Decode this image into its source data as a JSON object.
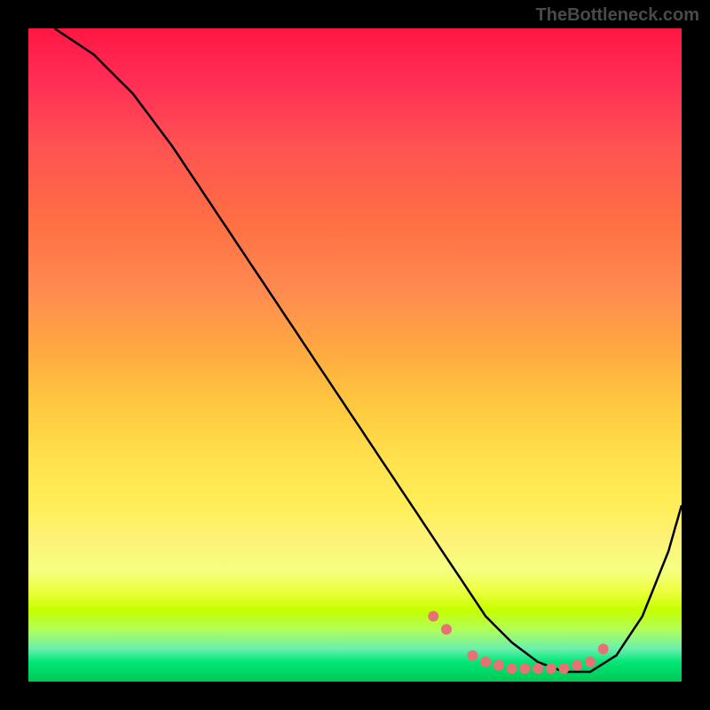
{
  "watermark": "TheBottleneck.com",
  "chart_data": {
    "type": "line",
    "title": "",
    "xlabel": "",
    "ylabel": "",
    "xlim": [
      0,
      100
    ],
    "ylim": [
      0,
      100
    ],
    "curve": {
      "x": [
        4,
        10,
        16,
        22,
        28,
        34,
        40,
        46,
        52,
        58,
        62,
        66,
        70,
        74,
        78,
        82,
        86,
        90,
        94,
        98,
        100
      ],
      "y": [
        100,
        96,
        90,
        82,
        73,
        64,
        55,
        46,
        37,
        28,
        22,
        16,
        10,
        6,
        3,
        1.5,
        1.5,
        4,
        10,
        20,
        27
      ]
    },
    "markers": {
      "x": [
        62,
        64,
        68,
        70,
        72,
        74,
        76,
        78,
        80,
        82,
        84,
        86,
        88
      ],
      "y": [
        10,
        8,
        4,
        3,
        2.5,
        2,
        2,
        2,
        2,
        2,
        2.5,
        3,
        5
      ]
    },
    "marker_color": "#e57373",
    "gradient_stops": [
      {
        "pos": 0,
        "color": "#ff1744"
      },
      {
        "pos": 50,
        "color": "#ffc107"
      },
      {
        "pos": 85,
        "color": "#ffeb3b"
      },
      {
        "pos": 100,
        "color": "#00c853"
      }
    ]
  }
}
